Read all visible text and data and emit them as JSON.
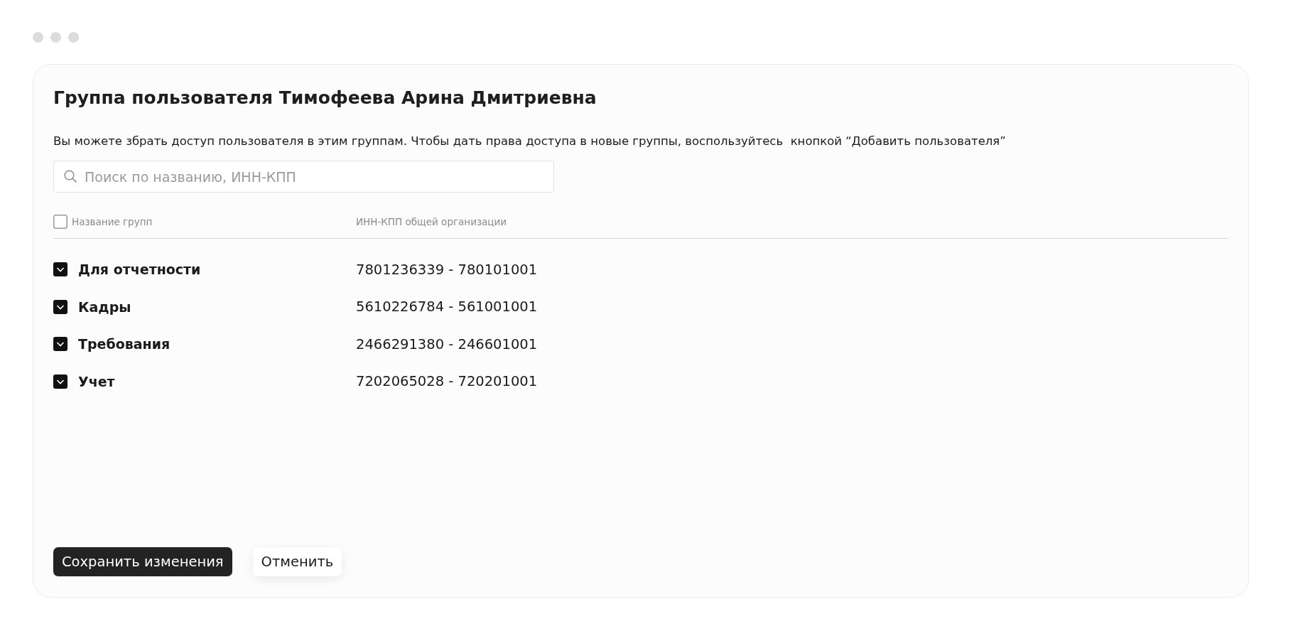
{
  "dialog": {
    "title": "Группа пользователя Тимофеева Арина Дмитриевна",
    "description": "Вы можете збрать доступ пользователя в этим группам. Чтобы дать права доступа в новые группы, воспользуйтесь  кнопкой “Добавить пользователя”",
    "search": {
      "placeholder": "Поиск по названию, ИНН-КПП"
    }
  },
  "table": {
    "select_all": {
      "checked": false
    },
    "columns": [
      "Название групп",
      "ИНН-КПП общей организации"
    ],
    "rows": [
      {
        "name": "Для отчетности",
        "inn_kpp": "7801236339 - 780101001",
        "checked": true
      },
      {
        "name": "Кадры",
        "inn_kpp": "5610226784 - 561001001",
        "checked": true
      },
      {
        "name": "Требования",
        "inn_kpp": "2466291380 - 246601001",
        "checked": true
      },
      {
        "name": "Учет",
        "inn_kpp": "7202065028 - 720201001",
        "checked": true
      }
    ]
  },
  "buttons": [
    {
      "label": "Сохранить изменения",
      "kind": "primary"
    },
    {
      "label": "Отменить",
      "kind": "secondary"
    }
  ]
}
